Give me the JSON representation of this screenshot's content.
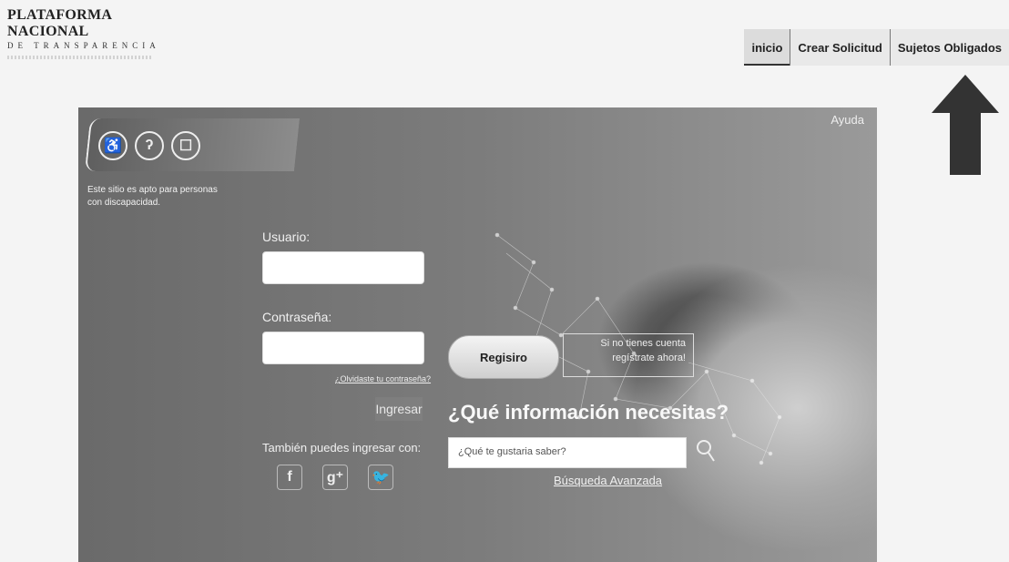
{
  "logo": {
    "line1": "PLATAFORMA NACIONAL",
    "line2": "DE TRANSPARENCIA"
  },
  "nav": {
    "items": [
      {
        "label": "inicio"
      },
      {
        "label": "Crear Solicitud"
      },
      {
        "label": "Sujetos Obligados"
      }
    ]
  },
  "header": {
    "help": "Ayuda"
  },
  "accessibility": {
    "text": "Este sitio es apto para personas con discapacidad.",
    "icons": [
      "wheelchair-icon",
      "ear-icon",
      "speech-bubble-icon"
    ]
  },
  "login": {
    "username_label": "Usuario:",
    "password_label": "Contraseña:",
    "forgot_label": "¿Olvidaste tu contraseña?",
    "submit_label": "Ingresar",
    "also_label": "También puedes ingresar con:",
    "social": [
      "facebook-icon",
      "google-plus-icon",
      "twitter-icon"
    ]
  },
  "register": {
    "button_label": "Regisiro",
    "prompt_line1": "Si no tienes cuenta",
    "prompt_line2": "regístrate ahora!"
  },
  "search": {
    "question": "¿Qué información necesitas?",
    "placeholder": "¿Qué te gustaria saber?",
    "advanced_label": "Búsqueda Avanzada"
  },
  "colors": {
    "panel_dark": "#6a6a6a",
    "arrow": "#333333"
  }
}
